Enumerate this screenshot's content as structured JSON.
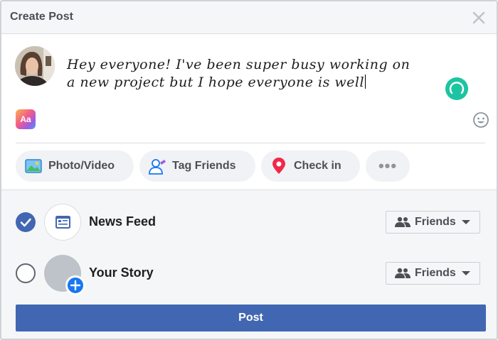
{
  "header": {
    "title": "Create Post"
  },
  "composer": {
    "text_line1": "Hey everyone! I've been super busy working on",
    "text_line2": "a new project but I hope everyone is well",
    "aa_label": "Aa"
  },
  "actions": {
    "photo_video": "Photo/Video",
    "tag_friends": "Tag Friends",
    "check_in": "Check in",
    "more": "•••"
  },
  "audience": {
    "news_feed": {
      "label": "News Feed",
      "privacy": "Friends",
      "selected": true
    },
    "your_story": {
      "label": "Your Story",
      "privacy": "Friends",
      "selected": false
    }
  },
  "post_button": "Post",
  "colors": {
    "accent": "#4267b2",
    "spinner": "#1cc5a0",
    "header_bg": "#f5f6f7"
  }
}
